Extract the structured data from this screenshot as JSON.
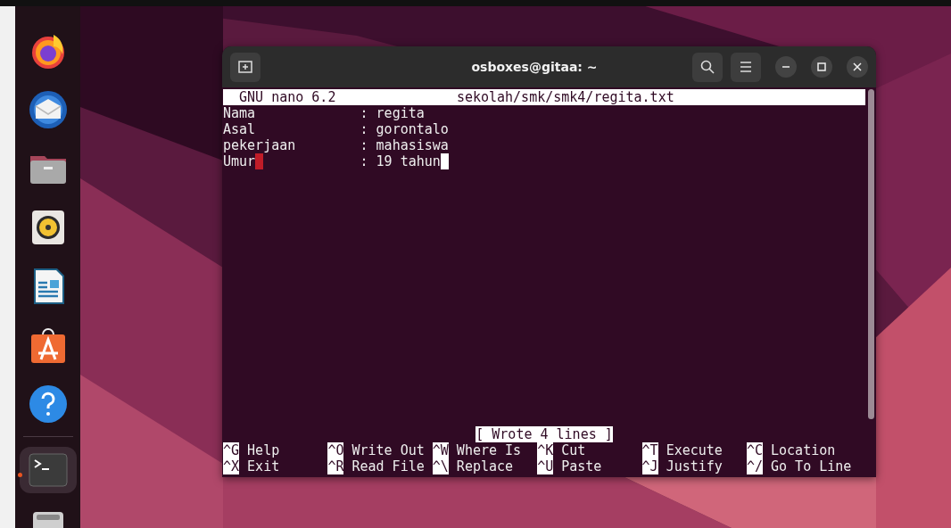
{
  "dock": {
    "items": [
      {
        "kind": "browser",
        "selected": false
      },
      {
        "kind": "mail",
        "selected": false
      },
      {
        "kind": "folder",
        "selected": false
      },
      {
        "kind": "speaker",
        "selected": false
      },
      {
        "kind": "document",
        "selected": false
      },
      {
        "kind": "store",
        "selected": false
      },
      {
        "kind": "help",
        "selected": false
      },
      {
        "kind": "separator"
      },
      {
        "kind": "terminal",
        "selected": true,
        "running": true
      },
      {
        "kind": "drive",
        "selected": false
      }
    ]
  },
  "window": {
    "title": "osboxes@gitaa: ~",
    "nano": {
      "version": "GNU nano 6.2",
      "filename": "sekolah/smk/smk4/regita.txt",
      "lines": [
        {
          "label": "Nama",
          "value": ": regita",
          "trailing_mark": false,
          "cursor": false
        },
        {
          "label": "Asal",
          "value": ": gorontalo",
          "trailing_mark": false,
          "cursor": false
        },
        {
          "label": "pekerjaan",
          "value": ": mahasiswa",
          "trailing_mark": false,
          "cursor": false
        },
        {
          "label": "Umur",
          "value": ": 19 tahun",
          "trailing_mark": true,
          "cursor": true
        }
      ],
      "status": "[ Wrote 4 lines ]",
      "shortcuts": [
        {
          "key": "^G",
          "label": "Help"
        },
        {
          "key": "^O",
          "label": "Write Out"
        },
        {
          "key": "^W",
          "label": "Where Is"
        },
        {
          "key": "^K",
          "label": "Cut"
        },
        {
          "key": "^T",
          "label": "Execute"
        },
        {
          "key": "^C",
          "label": "Location"
        },
        {
          "key": "^X",
          "label": "Exit"
        },
        {
          "key": "^R",
          "label": "Read File"
        },
        {
          "key": "^\\",
          "label": "Replace"
        },
        {
          "key": "^U",
          "label": "Paste"
        },
        {
          "key": "^J",
          "label": "Justify"
        },
        {
          "key": "^/",
          "label": "Go To Line"
        }
      ]
    }
  }
}
